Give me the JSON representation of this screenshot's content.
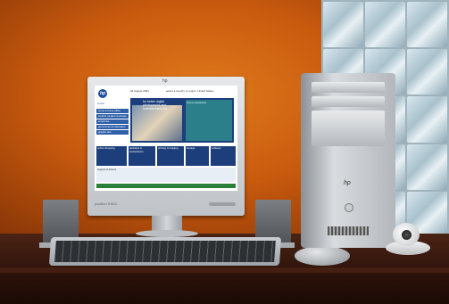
{
  "scene": {
    "description_items": [
      "monitor",
      "tower",
      "keyboard",
      "mouse",
      "speakers",
      "webcam"
    ]
  },
  "monitor": {
    "brand": "hp",
    "model_label": "pavilion f1503"
  },
  "webpage": {
    "logo_text": "hp",
    "brand_text": "invent",
    "date_text": "02 August 2004",
    "topbar_text": "select a country or region: United States",
    "hero_text": "for better digital photographs and entertainment fun",
    "hero_right_text": "home customers",
    "nav_items": [
      "home & home office",
      "small & medium business",
      "enterprise",
      "government & education",
      "graphic arts"
    ],
    "mid_cols": [
      "online shopping",
      "desktops & workstations",
      "printing & imaging",
      "storage",
      "software"
    ],
    "lower_text": "support & drivers",
    "footer_text": "© 2004 Hewlett-Packard Company"
  },
  "tower": {
    "logo_text": "hp"
  },
  "colors": {
    "wall": "#c85a0e",
    "desk": "#2b120a",
    "hp_blue": "#1f4f9a",
    "teal": "#2a7f8a"
  }
}
